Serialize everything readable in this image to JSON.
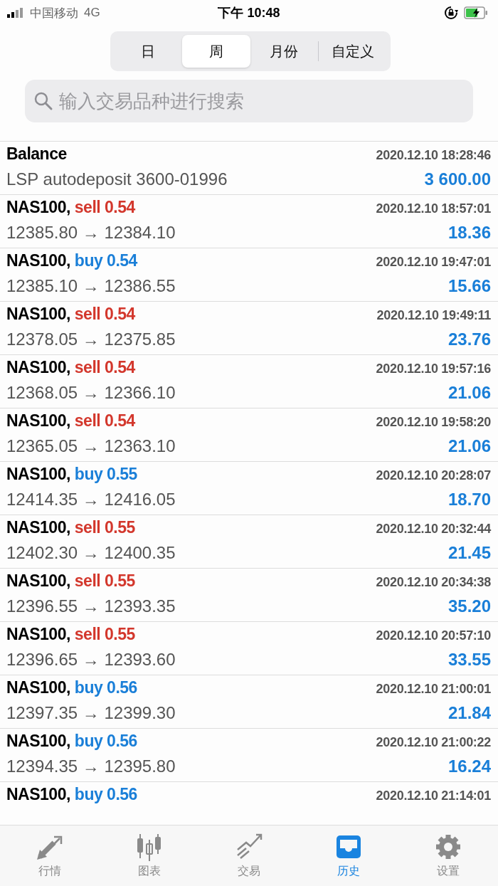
{
  "status_bar": {
    "carrier": "中国移动",
    "network": "4G",
    "time": "下午 10:48"
  },
  "periods": [
    {
      "label": "日",
      "selected": false
    },
    {
      "label": "周",
      "selected": true
    },
    {
      "label": "月份",
      "selected": false
    },
    {
      "label": "自定义",
      "selected": false
    }
  ],
  "search": {
    "placeholder": "输入交易品种进行搜索"
  },
  "rows": [
    {
      "kind": "balance",
      "title": "Balance",
      "time": "2020.12.10 18:28:46",
      "detail": "LSP autodeposit 3600-01996",
      "amount": "3 600.00"
    },
    {
      "kind": "trade",
      "title": "NAS100,",
      "deal": {
        "kind": "sell",
        "text": "sell 0.54"
      },
      "time": "2020.12.10 18:57:01",
      "detail": "12385.80 → 12384.10",
      "amount": "18.36"
    },
    {
      "kind": "trade",
      "title": "NAS100,",
      "deal": {
        "kind": "buy",
        "text": "buy 0.54"
      },
      "time": "2020.12.10 19:47:01",
      "detail": "12385.10 → 12386.55",
      "amount": "15.66"
    },
    {
      "kind": "trade",
      "title": "NAS100,",
      "deal": {
        "kind": "sell",
        "text": "sell 0.54"
      },
      "time": "2020.12.10 19:49:11",
      "detail": "12378.05 → 12375.85",
      "amount": "23.76"
    },
    {
      "kind": "trade",
      "title": "NAS100,",
      "deal": {
        "kind": "sell",
        "text": "sell 0.54"
      },
      "time": "2020.12.10 19:57:16",
      "detail": "12368.05 → 12366.10",
      "amount": "21.06"
    },
    {
      "kind": "trade",
      "title": "NAS100,",
      "deal": {
        "kind": "sell",
        "text": "sell 0.54"
      },
      "time": "2020.12.10 19:58:20",
      "detail": "12365.05 → 12363.10",
      "amount": "21.06"
    },
    {
      "kind": "trade",
      "title": "NAS100,",
      "deal": {
        "kind": "buy",
        "text": "buy 0.55"
      },
      "time": "2020.12.10 20:28:07",
      "detail": "12414.35 → 12416.05",
      "amount": "18.70"
    },
    {
      "kind": "trade",
      "title": "NAS100,",
      "deal": {
        "kind": "sell",
        "text": "sell 0.55"
      },
      "time": "2020.12.10 20:32:44",
      "detail": "12402.30 → 12400.35",
      "amount": "21.45"
    },
    {
      "kind": "trade",
      "title": "NAS100,",
      "deal": {
        "kind": "sell",
        "text": "sell 0.55"
      },
      "time": "2020.12.10 20:34:38",
      "detail": "12396.55 → 12393.35",
      "amount": "35.20"
    },
    {
      "kind": "trade",
      "title": "NAS100,",
      "deal": {
        "kind": "sell",
        "text": "sell 0.55"
      },
      "time": "2020.12.10 20:57:10",
      "detail": "12396.65 → 12393.60",
      "amount": "33.55"
    },
    {
      "kind": "trade",
      "title": "NAS100,",
      "deal": {
        "kind": "buy",
        "text": "buy 0.56"
      },
      "time": "2020.12.10 21:00:01",
      "detail": "12397.35 → 12399.30",
      "amount": "21.84"
    },
    {
      "kind": "trade",
      "title": "NAS100,",
      "deal": {
        "kind": "buy",
        "text": "buy 0.56"
      },
      "time": "2020.12.10 21:00:22",
      "detail": "12394.35 → 12395.80",
      "amount": "16.24"
    },
    {
      "kind": "trade",
      "title": "NAS100,",
      "deal": {
        "kind": "buy",
        "text": "buy 0.56"
      },
      "time": "2020.12.10 21:14:01"
    }
  ],
  "tab_bar": [
    {
      "kind": "quotes",
      "label": "行情",
      "selected": false
    },
    {
      "kind": "chart",
      "label": "图表",
      "selected": false
    },
    {
      "kind": "trade",
      "label": "交易",
      "selected": false
    },
    {
      "kind": "history",
      "label": "历史",
      "selected": true
    },
    {
      "kind": "settings",
      "label": "设置",
      "selected": false
    }
  ]
}
